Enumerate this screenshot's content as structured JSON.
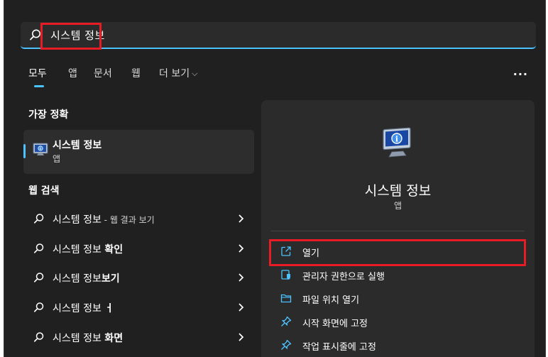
{
  "search": {
    "query": "시스템 정보"
  },
  "tabs": [
    {
      "label": "모두"
    },
    {
      "label": "앱"
    },
    {
      "label": "문서"
    },
    {
      "label": "웹"
    },
    {
      "label": "더 보기"
    }
  ],
  "best_match": {
    "header": "가장 정확",
    "title": "시스템 정보",
    "subtitle": "앱"
  },
  "web_search": {
    "header": "웹 검색",
    "items": [
      {
        "prefix": "시스템 정보",
        "bold": "",
        "suffix": " - 웹 결과 보기"
      },
      {
        "prefix": "시스템 정보 ",
        "bold": "확인",
        "suffix": ""
      },
      {
        "prefix": "시스템 정보",
        "bold": "보기",
        "suffix": ""
      },
      {
        "prefix": "시스템 정보 ",
        "bold": "ㅓ",
        "suffix": ""
      },
      {
        "prefix": "시스템 정보 ",
        "bold": "화면",
        "suffix": ""
      }
    ]
  },
  "detail": {
    "app_name": "시스템 정보",
    "app_type": "앱",
    "actions": [
      {
        "label": "열기",
        "icon": "open-icon"
      },
      {
        "label": "관리자 권한으로 실행",
        "icon": "admin-shield-icon"
      },
      {
        "label": "파일 위치 열기",
        "icon": "folder-icon"
      },
      {
        "label": "시작 화면에 고정",
        "icon": "pin-icon"
      },
      {
        "label": "작업 표시줄에 고정",
        "icon": "pin-icon"
      }
    ]
  },
  "colors": {
    "accent": "#4cc2ff",
    "highlight": "#e81c24",
    "background": "#202020"
  }
}
